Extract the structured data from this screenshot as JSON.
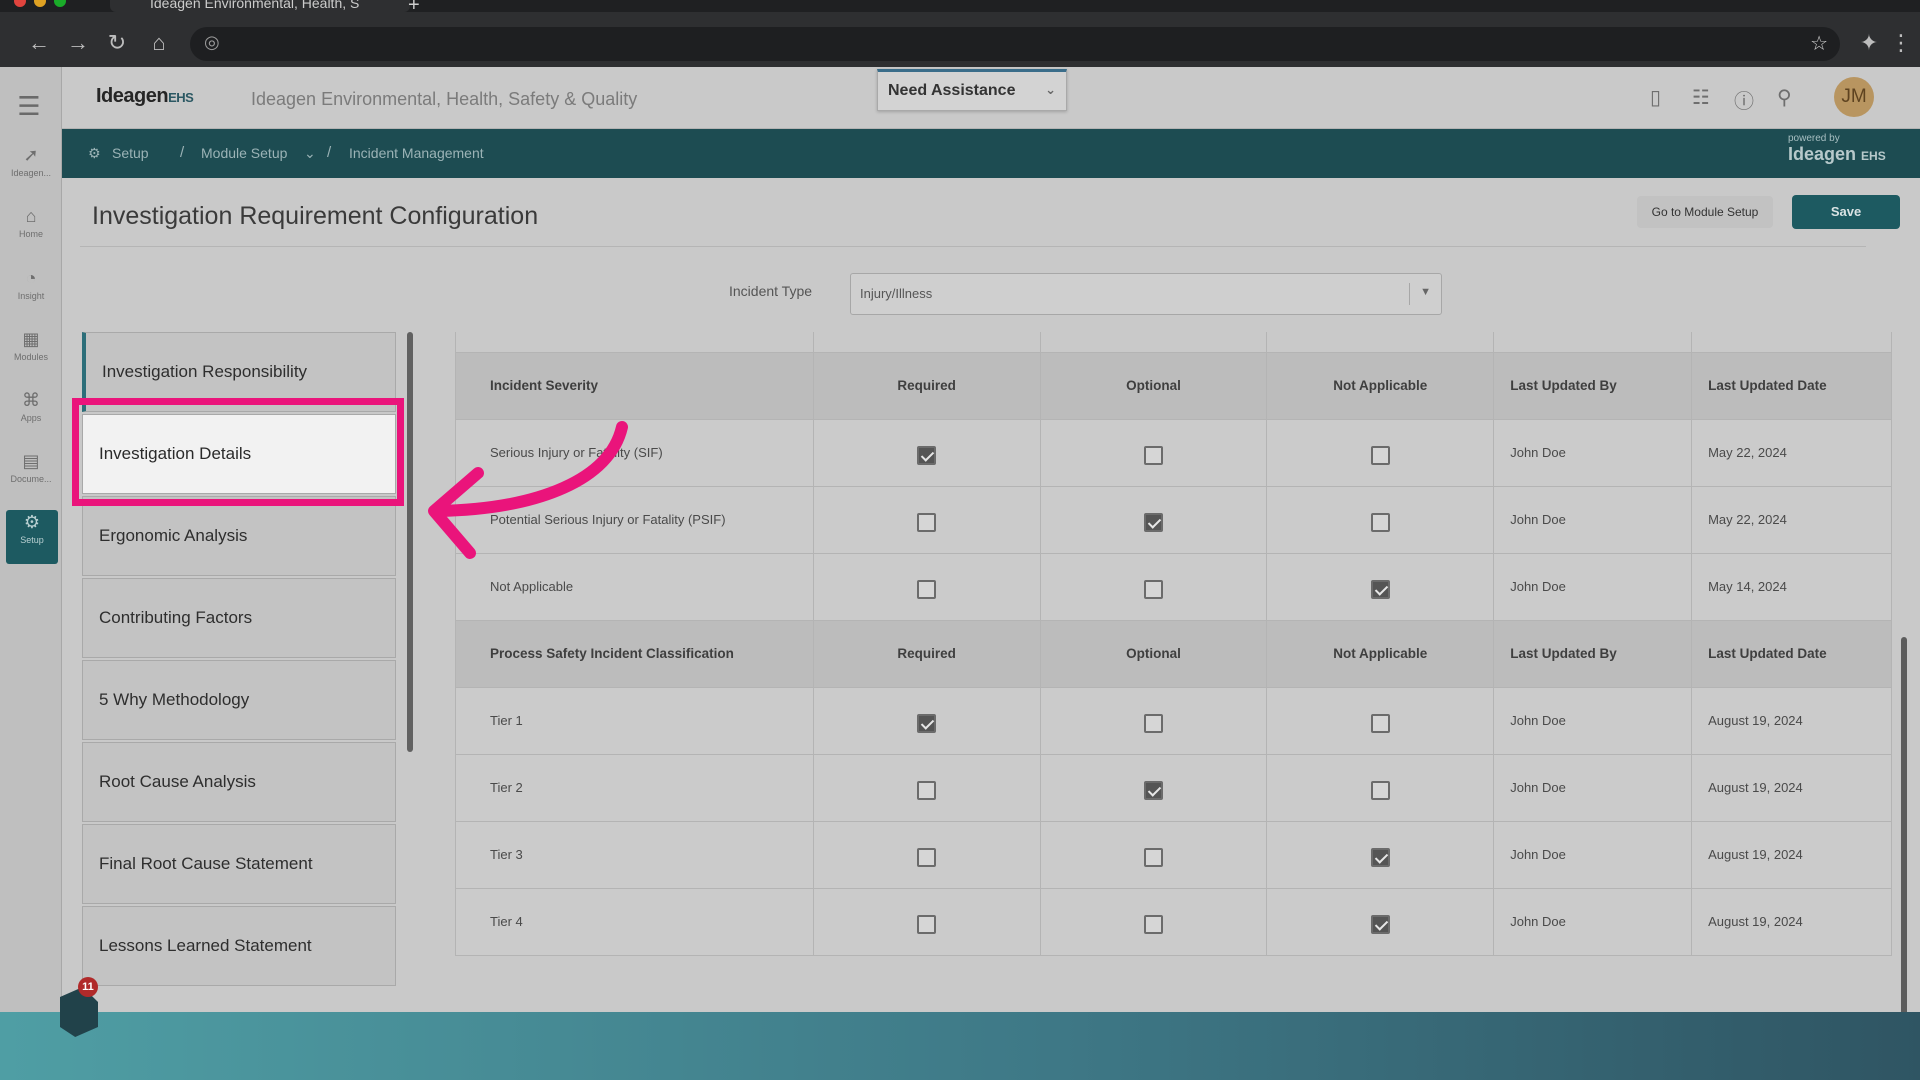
{
  "browser": {
    "tab_title": "Ideagen Environmental, Health, S"
  },
  "header": {
    "logo": "Ideagen",
    "logo_suffix": "EHS",
    "app_title": "Ideagen Environmental, Health, Safety & Quality",
    "assist_label": "Need Assistance",
    "avatar_initials": "JM"
  },
  "leftnav": [
    {
      "label": "Ideagen...",
      "icon": "ideagen-icon"
    },
    {
      "label": "Home",
      "icon": "home-icon"
    },
    {
      "label": "Insight",
      "icon": "insight-icon"
    },
    {
      "label": "Modules",
      "icon": "modules-icon"
    },
    {
      "label": "Apps",
      "icon": "apps-icon"
    },
    {
      "label": "Docume...",
      "icon": "document-icon"
    },
    {
      "label": "Setup",
      "icon": "gear-icon"
    }
  ],
  "breadcrumb": {
    "setup": "Setup",
    "module_setup": "Module Setup",
    "current": "Incident Management",
    "powered_by": "powered by",
    "powered_logo": "Ideagen",
    "powered_suffix": "EHS"
  },
  "page": {
    "title": "Investigation Requirement Configuration",
    "goto_label": "Go to Module Setup",
    "save_label": "Save",
    "incident_type_label": "Incident Type",
    "incident_type_value": "Injury/Illness"
  },
  "sections": [
    "Investigation Responsibility",
    "Investigation Details",
    "Ergonomic Analysis",
    "Contributing Factors",
    "5 Why Methodology",
    "Root Cause Analysis",
    "Final Root Cause Statement",
    "Lessons Learned Statement"
  ],
  "notification_count": "11",
  "table": {
    "group1": {
      "headers": [
        "Incident Severity",
        "Required",
        "Optional",
        "Not Applicable",
        "Last Updated By",
        "Last Updated Date"
      ],
      "rows": [
        {
          "name": "Serious Injury or Fatality (SIF)",
          "req": true,
          "opt": false,
          "na": false,
          "by": "John Doe",
          "date": "May 22, 2024"
        },
        {
          "name": "Potential Serious Injury or Fatality (PSIF)",
          "req": false,
          "opt": true,
          "na": false,
          "by": "John Doe",
          "date": "May 22, 2024"
        },
        {
          "name": "Not Applicable",
          "req": false,
          "opt": false,
          "na": true,
          "by": "John Doe",
          "date": "May 14, 2024"
        }
      ]
    },
    "group2": {
      "headers": [
        "Process Safety Incident Classification",
        "Required",
        "Optional",
        "Not Applicable",
        "Last Updated By",
        "Last Updated Date"
      ],
      "rows": [
        {
          "name": "Tier 1",
          "req": true,
          "opt": false,
          "na": false,
          "by": "John Doe",
          "date": "August 19, 2024"
        },
        {
          "name": "Tier 2",
          "req": false,
          "opt": true,
          "na": false,
          "by": "John Doe",
          "date": "August 19, 2024"
        },
        {
          "name": "Tier 3",
          "req": false,
          "opt": false,
          "na": true,
          "by": "John Doe",
          "date": "August 19, 2024"
        },
        {
          "name": "Tier 4",
          "req": false,
          "opt": false,
          "na": true,
          "by": "John Doe",
          "date": "August 19, 2024"
        }
      ]
    }
  },
  "colors": {
    "accent": "#1d5a61",
    "highlight": "#ea147b"
  }
}
